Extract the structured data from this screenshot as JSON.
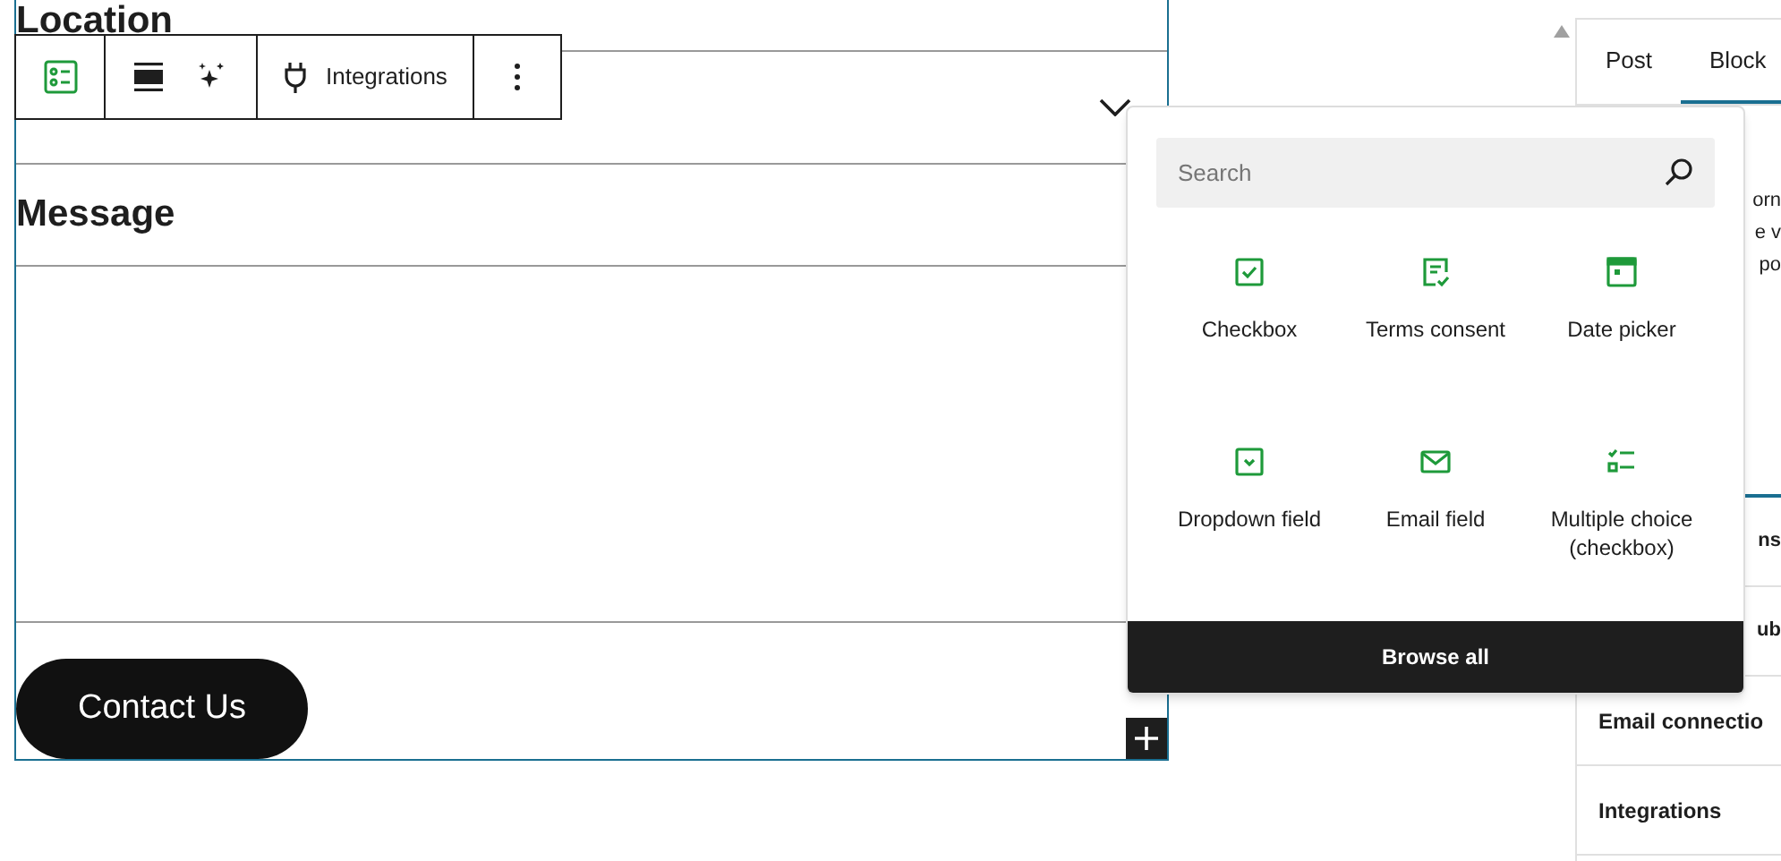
{
  "form": {
    "fields": [
      {
        "kind": "select",
        "label": "Location"
      },
      {
        "kind": "textarea",
        "label": "Message"
      }
    ],
    "submit": "Contact Us"
  },
  "toolbar": {
    "integrations": "Integrations"
  },
  "inserter": {
    "search": {
      "placeholder": "Search"
    },
    "blocks": [
      {
        "kind": "checkbox",
        "label": "Checkbox"
      },
      {
        "kind": "terms",
        "label": "Terms consent"
      },
      {
        "kind": "date",
        "label": "Date picker"
      },
      {
        "kind": "dropdown",
        "label": "Dropdown field"
      },
      {
        "kind": "email",
        "label": "Email field"
      },
      {
        "kind": "multiple",
        "label": "Multiple choice (checkbox)"
      }
    ],
    "browse_all": "Browse all"
  },
  "sidebar": {
    "tabs": [
      {
        "label": "Post",
        "selected": false
      },
      {
        "label": "Block",
        "selected": true
      }
    ],
    "description": [
      "orn",
      "e v",
      "po"
    ],
    "panels": [
      "ns",
      "ub",
      "Email connectio",
      "Integrations"
    ]
  }
}
